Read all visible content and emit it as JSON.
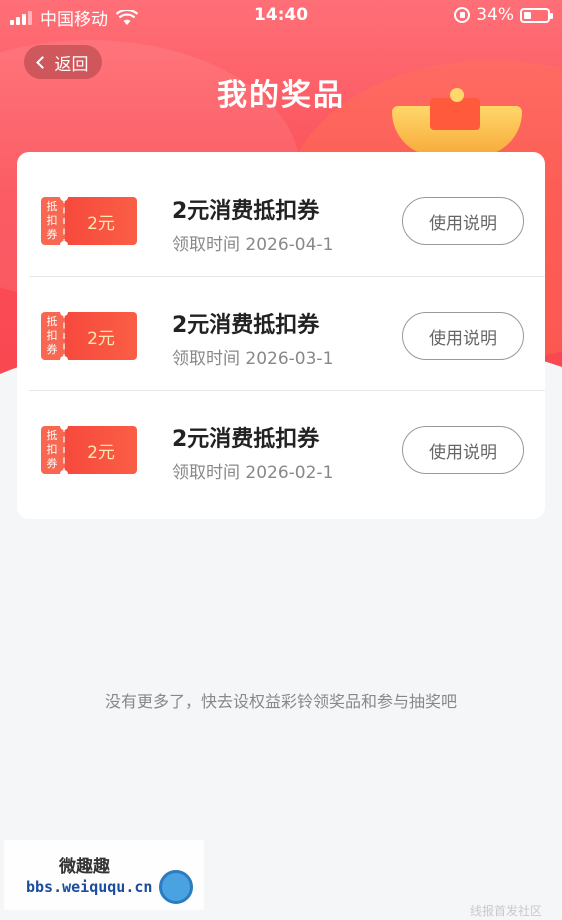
{
  "status_bar": {
    "carrier": "中国移动",
    "time": "14:40",
    "battery": "34%",
    "battery_level": 0.34
  },
  "nav": {
    "back_label": "返回",
    "title": "我的奖品"
  },
  "prizes": [
    {
      "badge": "抵扣券",
      "value": "2元",
      "title": "2元消费抵扣券",
      "date": "领取时间 2026-04-1",
      "button": "使用说明"
    },
    {
      "badge": "抵扣券",
      "value": "2元",
      "title": "2元消费抵扣券",
      "date": "领取时间 2026-03-1",
      "button": "使用说明"
    },
    {
      "badge": "抵扣券",
      "value": "2元",
      "title": "2元消费抵扣券",
      "date": "领取时间 2026-02-1",
      "button": "使用说明"
    }
  ],
  "empty_hint": "没有更多了，快去设权益彩铃领奖品和参与抽奖吧",
  "watermark": {
    "name": "微趣趣",
    "url": "bbs.weiququ.cn",
    "corner": "线报首发社区"
  },
  "colors": {
    "header_red": "#fb5058",
    "coupon_red": "#f7493e",
    "background": "#f5f6f8"
  }
}
